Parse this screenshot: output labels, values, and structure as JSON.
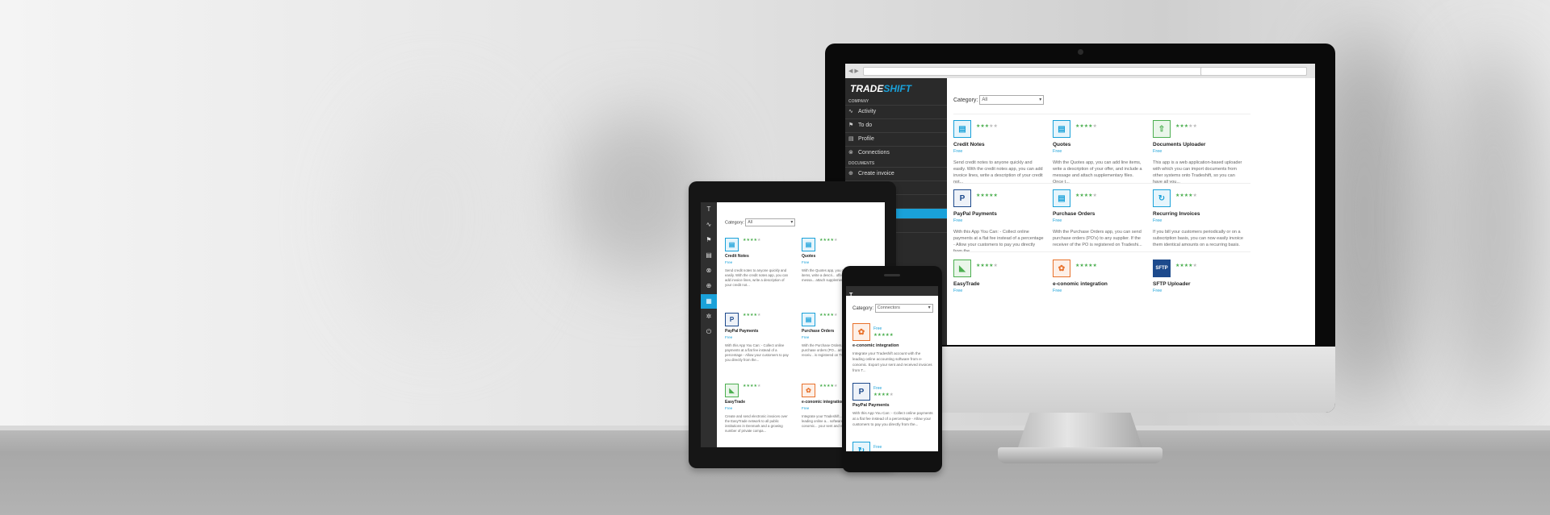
{
  "colors": {
    "accent": "#1aa1d9",
    "sidebar": "#2a2a2a",
    "stars": "#4caf50"
  },
  "desktop": {
    "logo_a": "TRADE",
    "logo_b": "SHIFT",
    "sidebar": {
      "section_company": "COMPANY",
      "section_documents": "DOCUMENTS",
      "items": [
        {
          "label": "Activity",
          "icon": "activity-icon"
        },
        {
          "label": "To do",
          "icon": "flag-icon"
        },
        {
          "label": "Profile",
          "icon": "profile-icon"
        },
        {
          "label": "Connections",
          "icon": "connections-icon"
        },
        {
          "label": "Create invoice",
          "icon": "plus-circle-icon"
        }
      ]
    },
    "category_label": "Category:",
    "category_value": "All",
    "apps": [
      {
        "name": "Credit Notes",
        "price": "Free",
        "rating": 3,
        "desc": "Send credit notes to anyone quickly and easily. With the credit notes app, you can add invoice lines, write a description of your credit not..."
      },
      {
        "name": "Quotes",
        "price": "Free",
        "rating": 4,
        "desc": "With the Quotes app, you can add line items, write a description of your offer, and include a message and attach supplementary files. Once t..."
      },
      {
        "name": "Documents Uploader",
        "price": "Free",
        "rating": 3,
        "desc": "This app is a web application-based uploader with which you can import documents from other systems onto Tradeshift, so you can have all you..."
      },
      {
        "name": "PayPal Payments",
        "price": "Free",
        "rating": 5,
        "desc": "With this App You Can: - Collect online payments at a flat fee instead of a percentage - Allow your customers to pay you directly from the ..."
      },
      {
        "name": "Purchase Orders",
        "price": "Free",
        "rating": 4,
        "desc": "With the Purchase Orders app, you can send purchase orders (PO's) to any supplier. If the receiver of the PO is registered on Tradeshi..."
      },
      {
        "name": "Recurring Invoices",
        "price": "Free",
        "rating": 4,
        "desc": "If you bill your customers periodically or on a subscription basis, you can now easily invoice them identical amounts on a recurring basis. ..."
      },
      {
        "name": "EasyTrade",
        "price": "Free",
        "rating": 4,
        "desc": ""
      },
      {
        "name": "e-conomic integration",
        "price": "Free",
        "rating": 5,
        "desc": ""
      },
      {
        "name": "SFTP Uploader",
        "price": "Free",
        "rating": 4,
        "desc": ""
      }
    ]
  },
  "tablet": {
    "category_label": "Category:",
    "category_value": "All",
    "apps": [
      {
        "name": "Credit Notes",
        "price": "Free",
        "rating": 4,
        "desc": "Send credit notes to anyone quickly and easily. With the credit notes app, you can add invoice lines, write a description of your credit not..."
      },
      {
        "name": "Quotes",
        "price": "Free",
        "rating": 4,
        "desc": "With the Quotes app, you can add line items, write a descri... offer, and include a messa... attach supplementary files..."
      },
      {
        "name": "PayPal Payments",
        "price": "Free",
        "rating": 4,
        "desc": "With this App You Can: - Collect online payments at a flat fee instead of a percentage - Allow your customers to pay you directly from the..."
      },
      {
        "name": "Purchase Orders",
        "price": "Free",
        "rating": 4,
        "desc": "With the Purchase Orders... send purchase orders (PO... any supplier. If the receiv... is registered on Tradeshi..."
      },
      {
        "name": "EasyTrade",
        "price": "Free",
        "rating": 4,
        "desc": "Create and send electronic invoices over the EasyTrade network to all public institutions in Denmark and a growing number of private compa..."
      },
      {
        "name": "e-conomic integration",
        "price": "Free",
        "rating": 4,
        "desc": "Integrate your Tradeshift... with the leading online a... software from e-conomic... your sent and received..."
      }
    ]
  },
  "phone": {
    "logo": "T",
    "category_label": "Category:",
    "category_value": "Connectors",
    "apps": [
      {
        "name": "e-conomic integration",
        "price": "Free",
        "rating": 5,
        "desc": "Integrate your Tradeshift account with the leading online accounting software from e-conomic. Export your sent and received invoices from T..."
      },
      {
        "name": "PayPal Payments",
        "price": "Free",
        "rating": 4,
        "desc": "With this App You Can: - Collect online payments at a flat fee instead of a percentage - Allow your customers to pay you directly from the..."
      },
      {
        "name": "",
        "price": "Free",
        "rating": 0,
        "desc": ""
      }
    ]
  }
}
